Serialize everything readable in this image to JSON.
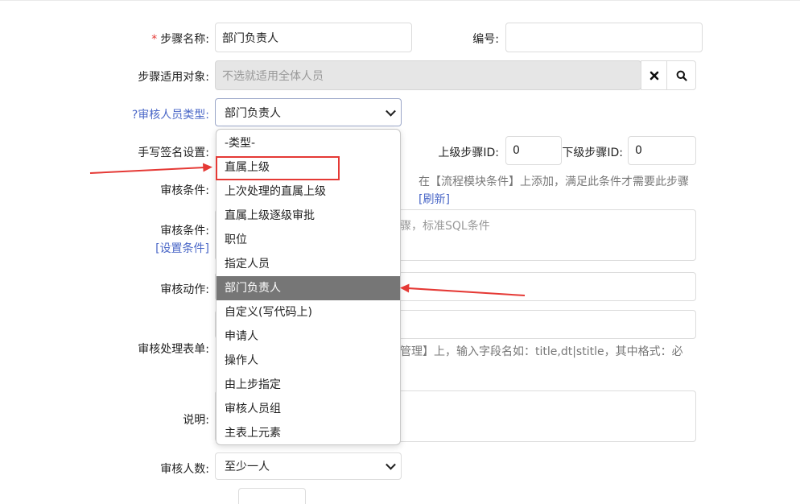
{
  "form": {
    "step_name": {
      "required_mark": "*",
      "label": "步骤名称:",
      "value": "部门负责人"
    },
    "number": {
      "label": "编号:",
      "value": ""
    },
    "target": {
      "label": "步骤适用对象:",
      "placeholder": "不选就适用全体人员",
      "clear_icon": "close-icon",
      "search_icon": "search-icon"
    },
    "reviewer_type": {
      "label": "?审核人员类型:",
      "selected": "部门负责人"
    },
    "handwriting": {
      "label": "手写签名设置:"
    },
    "upper_step": {
      "label": "上级步骤ID:",
      "value": "0"
    },
    "lower_step": {
      "label": "下级步骤ID:",
      "value": "0"
    },
    "condition1": {
      "label": "审核条件:",
      "hint": "在【流程模块条件】上添加，满足此条件才需要此步骤",
      "refresh_link": "[刷新]"
    },
    "condition2": {
      "label": "审核条件:",
      "set_link": "[设置条件]",
      "placeholder_partial": "骤，标准SQL条件"
    },
    "action": {
      "label": "审核动作:"
    },
    "form_handle": {
      "label": "审核处理表单:",
      "hint_partial": "管理】上，输入字段名如：title,dt|stitle，其中格式：必"
    },
    "description": {
      "label": "说明:"
    },
    "reviewer_count": {
      "label": "审核人数:",
      "selected": "至少一人"
    }
  },
  "dropdown": {
    "options": [
      "-类型-",
      "直属上级",
      "上次处理的直属上级",
      "直属上级逐级审批",
      "职位",
      "指定人员",
      "部门负责人",
      "自定义(写代码上)",
      "申请人",
      "操作人",
      "由上步指定",
      "审核人员组",
      "主表上元素"
    ],
    "highlighted_option": "直属上级",
    "selected_option": "部门负责人"
  },
  "colors": {
    "annotation": "#e53935",
    "selected_bg": "#767676",
    "link": "#4a67c7"
  }
}
